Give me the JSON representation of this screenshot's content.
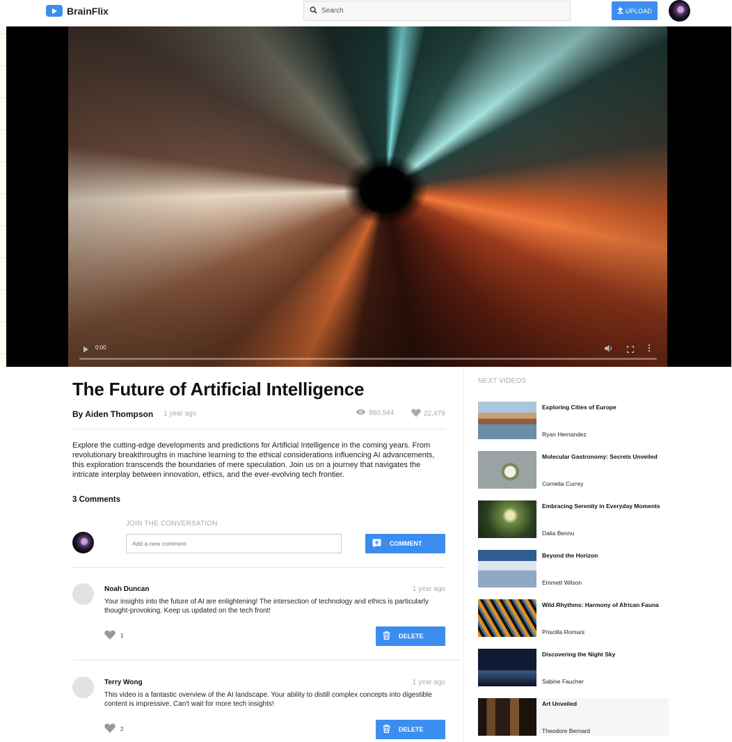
{
  "app": {
    "name": "BrainFlix"
  },
  "header": {
    "search_placeholder": "Search",
    "upload_label": "UPLOAD"
  },
  "player": {
    "time": "0:00"
  },
  "video": {
    "title": "The Future of Artificial Intelligence",
    "author": "By Aiden Thompson",
    "posted": "1 year ago",
    "views": "980,544",
    "likes": "22,479",
    "description": "Explore the cutting-edge developments and predictions for Artificial Intelligence in the coming years. From revolutionary breakthroughs in machine learning to the ethical considerations influencing AI advancements, this exploration transcends the boundaries of mere speculation. Join us on a journey that navigates the intricate interplay between innovation, ethics, and the ever-evolving tech frontier."
  },
  "comments_section": {
    "count_label": "3 Comments",
    "join_label": "JOIN THE CONVERSATION",
    "input_placeholder": "Add a new comment",
    "comment_button": "COMMENT",
    "delete_label": "DELETE",
    "items": [
      {
        "name": "Noah Duncan",
        "posted": "1 year ago",
        "text": "Your insights into the future of AI are enlightening! The intersection of technology and ethics is particularly thought-provoking. Keep us updated on the tech front!",
        "likes": "1"
      },
      {
        "name": "Terry Wong",
        "posted": "1 year ago",
        "text": "This video is a fantastic overview of the AI landscape. Your ability to distill complex concepts into digestible content is impressive. Can't wait for more tech insights!",
        "likes": "2"
      }
    ]
  },
  "next_videos": {
    "label": "NEXT VIDEOS",
    "items": [
      {
        "title": "Exploring Cities of Europe",
        "author": "Ryan Hernandez"
      },
      {
        "title": "Molecular Gastronomy: Secrets Unveiled",
        "author": "Cornelia Currey"
      },
      {
        "title": "Embracing Serenity in Everyday Moments",
        "author": "Dalia Bennu"
      },
      {
        "title": "Beyond the Horizon",
        "author": "Emmett Wilson"
      },
      {
        "title": "Wild Rhythms: Harmony of African Fauna",
        "author": "Priscilla Romani"
      },
      {
        "title": "Discovering the Night Sky",
        "author": "Sabine Faucher"
      },
      {
        "title": "Art Unveiled",
        "author": "Theodore Bernard"
      }
    ]
  },
  "colors": {
    "accent": "#3b8ef0",
    "muted_text": "#aaaaaa"
  }
}
